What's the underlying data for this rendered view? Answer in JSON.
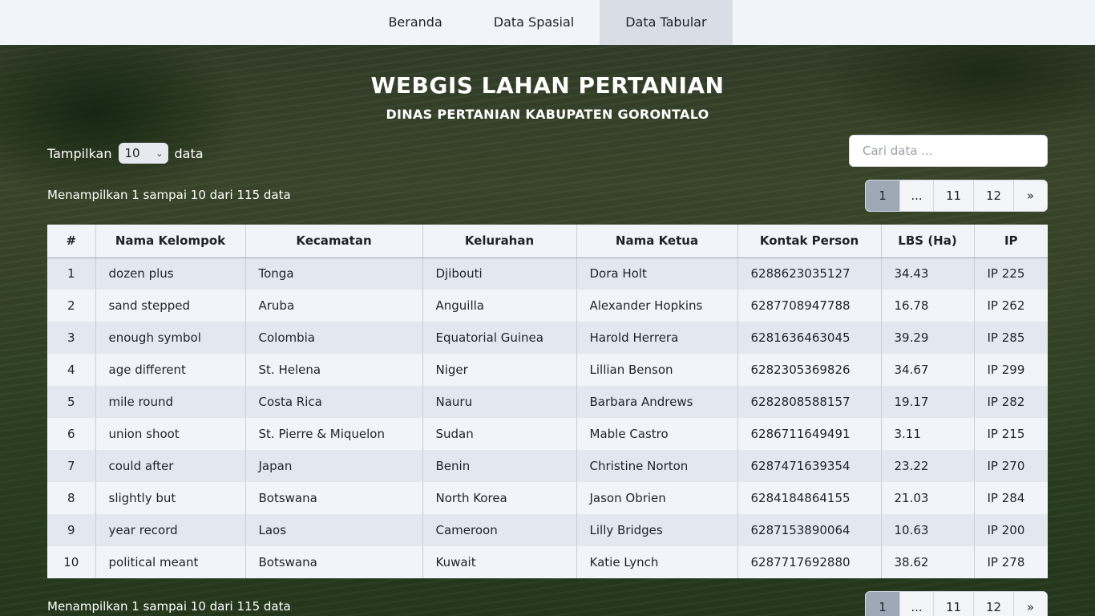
{
  "nav": {
    "items": [
      "Beranda",
      "Data Spasial",
      "Data Tabular"
    ],
    "active_index": 2
  },
  "header": {
    "title": "WEBGIS LAHAN PERTANIAN",
    "subtitle": "DINAS PERTANIAN KABUPATEN GORONTALO"
  },
  "controls": {
    "show_label": "Tampilkan",
    "page_size": "10",
    "show_suffix": "data",
    "search_placeholder": "Cari data ..."
  },
  "info": {
    "text": "Menampilkan 1 sampai 10 dari 115 data"
  },
  "pagination": {
    "pages": [
      "1",
      "...",
      "11",
      "12",
      "»"
    ],
    "active": "1"
  },
  "table": {
    "columns": [
      "#",
      "Nama Kelompok",
      "Kecamatan",
      "Kelurahan",
      "Nama Ketua",
      "Kontak Person",
      "LBS (Ha)",
      "IP"
    ],
    "rows": [
      [
        "1",
        "dozen plus",
        "Tonga",
        "Djibouti",
        "Dora Holt",
        "6288623035127",
        "34.43",
        "IP 225"
      ],
      [
        "2",
        "sand stepped",
        "Aruba",
        "Anguilla",
        "Alexander Hopkins",
        "6287708947788",
        "16.78",
        "IP 262"
      ],
      [
        "3",
        "enough symbol",
        "Colombia",
        "Equatorial Guinea",
        "Harold Herrera",
        "6281636463045",
        "39.29",
        "IP 285"
      ],
      [
        "4",
        "age different",
        "St. Helena",
        "Niger",
        "Lillian Benson",
        "6282305369826",
        "34.67",
        "IP 299"
      ],
      [
        "5",
        "mile round",
        "Costa Rica",
        "Nauru",
        "Barbara Andrews",
        "6282808588157",
        "19.17",
        "IP 282"
      ],
      [
        "6",
        "union shoot",
        "St. Pierre & Miquelon",
        "Sudan",
        "Mable Castro",
        "6286711649491",
        "3.11",
        "IP 215"
      ],
      [
        "7",
        "could after",
        "Japan",
        "Benin",
        "Christine Norton",
        "6287471639354",
        "23.22",
        "IP 270"
      ],
      [
        "8",
        "slightly but",
        "Botswana",
        "North Korea",
        "Jason Obrien",
        "6284184864155",
        "21.03",
        "IP 284"
      ],
      [
        "9",
        "year record",
        "Laos",
        "Cameroon",
        "Lilly Bridges",
        "6287153890064",
        "10.63",
        "IP 200"
      ],
      [
        "10",
        "political meant",
        "Botswana",
        "Kuwait",
        "Katie Lynch",
        "6287717692880",
        "38.62",
        "IP 278"
      ]
    ]
  }
}
